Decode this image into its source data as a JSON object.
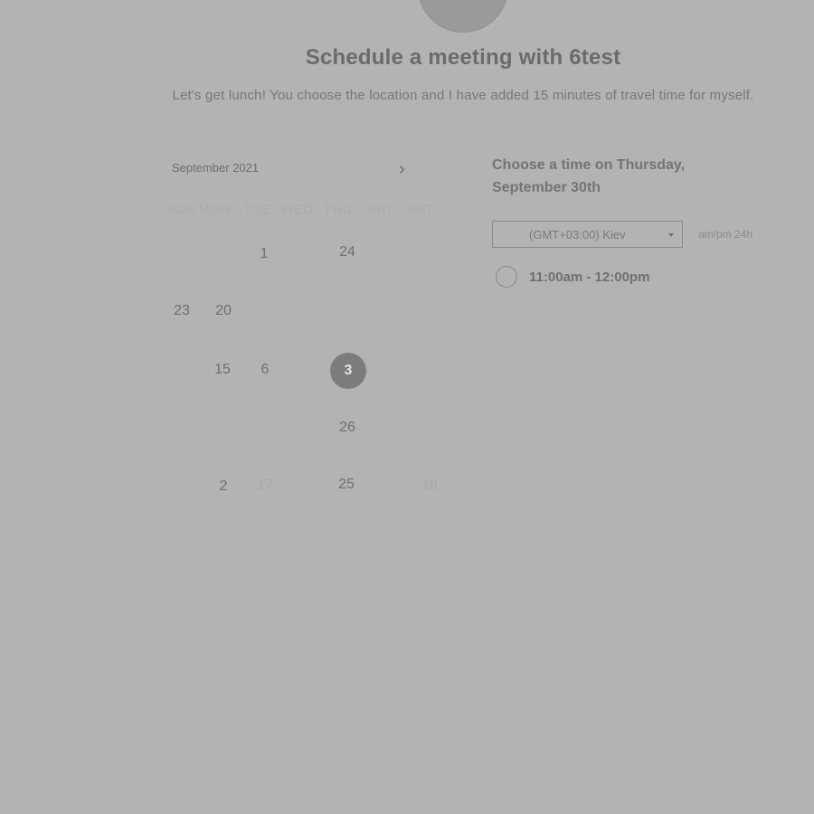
{
  "header": {
    "title": "Schedule a meeting with 6test",
    "description": "Let's get lunch! You choose the location and I have added 15 minutes of travel time for myself."
  },
  "calendar": {
    "month_label": "September 2021",
    "prev_icon": "chevron-left-icon",
    "next_icon": "chevron-right-icon",
    "weekdays": [
      "SUN",
      "MON",
      "TUE",
      "WED",
      "THU",
      "FRI",
      "SAT"
    ],
    "days": [
      "1",
      "24",
      "23",
      "20",
      "15",
      "6",
      "3",
      "26",
      "2",
      "17",
      "25",
      "19"
    ],
    "selected_day": "3"
  },
  "times": {
    "heading": "Choose a time on Thursday, September 30th",
    "timezone": "(GMT+03:00) Kiev",
    "format_toggle": "am/pm 24h",
    "slots": [
      "11:00am - 12:00pm"
    ]
  },
  "colors": {
    "background": "#b3b3b3",
    "selected_day": "#7c7c7c"
  }
}
